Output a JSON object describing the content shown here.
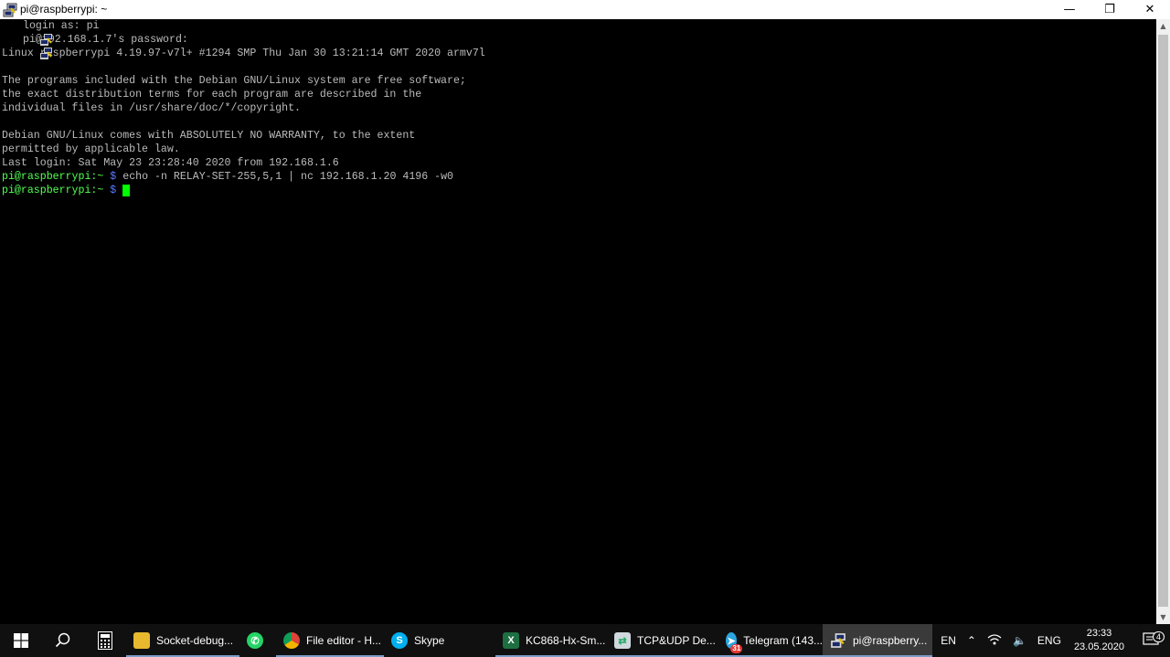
{
  "window": {
    "title": "pi@raspberrypi: ~",
    "minimize_glyph": "—",
    "restore_glyph": "❐",
    "close_glyph": "✕"
  },
  "terminal": {
    "login_line": "login as: pi",
    "password_line": "pi@192.168.1.7's password:",
    "kernel_line": "Linux raspberrypi 4.19.97-v7l+ #1294 SMP Thu Jan 30 13:21:14 GMT 2020 armv7l",
    "blank1": "",
    "programs_1": "The programs included with the Debian GNU/Linux system are free software;",
    "programs_2": "the exact distribution terms for each program are described in the",
    "programs_3": "individual files in /usr/share/doc/*/copyright.",
    "blank2": "",
    "warranty_1": "Debian GNU/Linux comes with ABSOLUTELY NO WARRANTY, to the extent",
    "warranty_2": "permitted by applicable law.",
    "last_login": "Last login: Sat May 23 23:28:40 2020 from 192.168.1.6",
    "prompt_user": "pi@raspberrypi:~",
    "prompt_dollar": "$",
    "command": "echo -n RELAY-SET-255,5,1 | nc 192.168.1.20 4196 -w0"
  },
  "taskbar": {
    "items": [
      {
        "label": "Socket-debug...",
        "icon": "folder-icon"
      },
      {
        "label": "",
        "icon": "whatsapp-icon"
      },
      {
        "label": "File editor - H...",
        "icon": "chrome-icon"
      },
      {
        "label": "Skype",
        "icon": "skype-icon"
      },
      {
        "label": "KC868-Hx-Sm...",
        "icon": "excel-icon"
      },
      {
        "label": "TCP&UDP De...",
        "icon": "tcpudp-icon"
      },
      {
        "label": "Telegram (143...",
        "icon": "telegram-icon"
      },
      {
        "label": "pi@raspberry...",
        "icon": "putty-icon"
      }
    ],
    "telegram_badge": "31",
    "lang_short": "EN",
    "lang_long": "ENG",
    "time": "23:33",
    "date": "23.05.2020",
    "notification_count": "4"
  },
  "colors": {
    "prompt": "#54ff54",
    "dollar": "#5b79ff",
    "cursor": "#00ff00",
    "terminal_text": "#bbbbbb",
    "taskbar": "#101010"
  }
}
